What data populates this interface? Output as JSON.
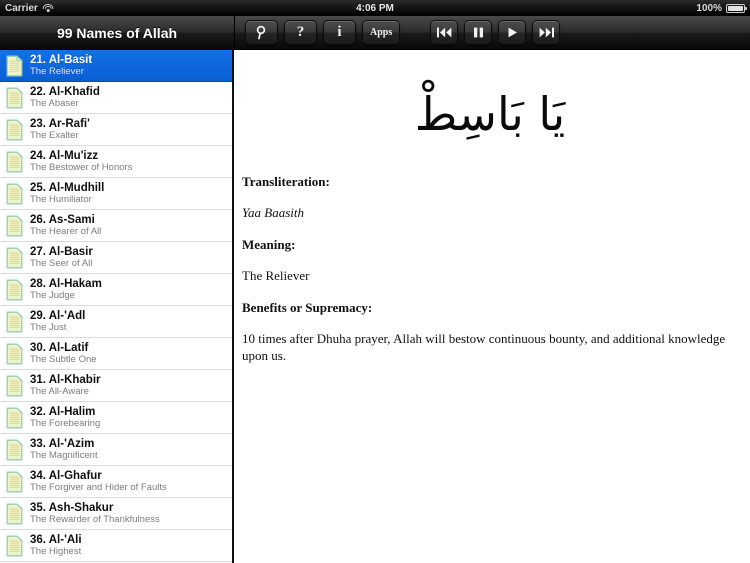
{
  "status_bar": {
    "carrier": "Carrier",
    "wifi_icon": "wifi-icon",
    "time": "4:06 PM",
    "battery_percent": "100%",
    "battery_icon": "battery-full-icon"
  },
  "navbar": {
    "title": "99 Names of Allah"
  },
  "toolbar": {
    "buttons": [
      {
        "name": "search-button",
        "icon": "search-icon",
        "label": ""
      },
      {
        "name": "help-button",
        "icon": "question-mark-icon",
        "label": "?"
      },
      {
        "name": "info-button",
        "icon": "info-icon",
        "label": "i"
      },
      {
        "name": "apps-button",
        "icon": "apps-icon",
        "label": "Apps"
      },
      {
        "name": "rewind-button",
        "icon": "rewind-icon",
        "label": ""
      },
      {
        "name": "pause-button",
        "icon": "pause-icon",
        "label": ""
      },
      {
        "name": "play-button",
        "icon": "play-icon",
        "label": ""
      },
      {
        "name": "fast-forward-button",
        "icon": "fast-forward-icon",
        "label": ""
      }
    ]
  },
  "sidebar": {
    "selected_index": 0,
    "items": [
      {
        "title": "21. Al-Basit",
        "subtitle": "The Reliever",
        "icon": "document-icon"
      },
      {
        "title": "22. Al-Khafid",
        "subtitle": "The Abaser",
        "icon": "document-icon"
      },
      {
        "title": "23. Ar-Rafi'",
        "subtitle": "The Exalter",
        "icon": "document-icon"
      },
      {
        "title": "24. Al-Mu'izz",
        "subtitle": "The Bestower of Honors",
        "icon": "document-icon"
      },
      {
        "title": "25. Al-Mudhill",
        "subtitle": "The Humiliator",
        "icon": "document-icon"
      },
      {
        "title": "26. As-Sami",
        "subtitle": "The Hearer of All",
        "icon": "document-icon"
      },
      {
        "title": "27. Al-Basir",
        "subtitle": "The Seer of All",
        "icon": "document-icon"
      },
      {
        "title": "28. Al-Hakam",
        "subtitle": "The Judge",
        "icon": "document-icon"
      },
      {
        "title": "29. Al-'Adl",
        "subtitle": "The Just",
        "icon": "document-icon"
      },
      {
        "title": "30. Al-Latif",
        "subtitle": "The Subtle One",
        "icon": "document-icon"
      },
      {
        "title": "31. Al-Khabir",
        "subtitle": "The All-Aware",
        "icon": "document-icon"
      },
      {
        "title": "32. Al-Halim",
        "subtitle": "The Forebearing",
        "icon": "document-icon"
      },
      {
        "title": "33. Al-'Azim",
        "subtitle": "The Magnificent",
        "icon": "document-icon"
      },
      {
        "title": "34. Al-Ghafur",
        "subtitle": "The Forgiver and Hider of Faults",
        "icon": "document-icon"
      },
      {
        "title": "35. Ash-Shakur",
        "subtitle": "The Rewarder of Thankfulness",
        "icon": "document-icon"
      },
      {
        "title": "36. Al-'Ali",
        "subtitle": "The Highest",
        "icon": "document-icon"
      }
    ]
  },
  "content": {
    "arabic": "يَا بَاسِطْ",
    "transliteration_heading": "Transliteration:",
    "transliteration_value": "Yaa Baasith",
    "meaning_heading": "Meaning:",
    "meaning_value": "The Reliever",
    "benefits_heading": "Benefits or Supremacy:",
    "benefits_value": "10 times after Dhuha prayer, Allah will bestow continuous bounty, and additional knowledge upon us."
  },
  "colors": {
    "selection_blue": "#1272e8",
    "navbar_black": "#1b1b1b",
    "icon_paper": "#f2f4c8",
    "icon_border": "#8ecfc0"
  }
}
